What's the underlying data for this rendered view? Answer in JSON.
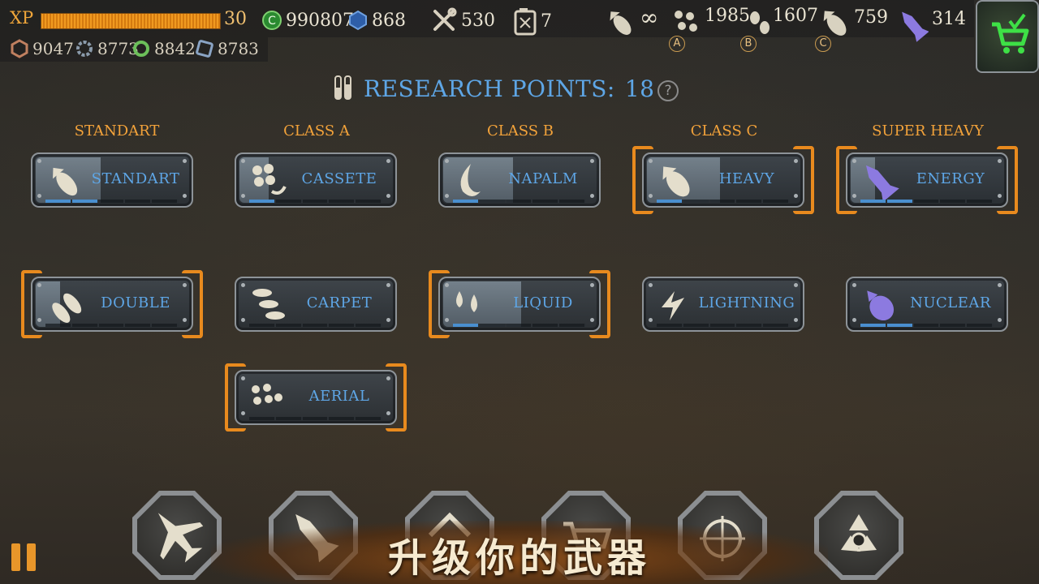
{
  "header": {
    "xp_label": "XP",
    "xp_level": "30",
    "xp_progress": 1.0,
    "credits": "990807",
    "gems": "868",
    "tools": "530",
    "fuel": "7",
    "ammo_standard": "∞",
    "ammo_a": "1985",
    "ammo_b": "1607",
    "ammo_c": "759",
    "ammo_super": "314",
    "sub_a": "A",
    "sub_b": "B",
    "sub_c": "C",
    "mat1": "9047",
    "mat2": "8773",
    "mat3": "8842",
    "mat4": "8783"
  },
  "research": {
    "label": "RESEARCH POINTS:",
    "points": "18",
    "help": "?"
  },
  "columns": [
    "STANDART",
    "CLASS A",
    "CLASS B",
    "CLASS C",
    "SUPER HEAVY"
  ],
  "weapons": {
    "standart": {
      "label": "STANDART",
      "progress": 0.4
    },
    "cassete": {
      "label": "CASSETE",
      "progress": 0.2
    },
    "napalm": {
      "label": "NAPALM",
      "progress": 0.2
    },
    "heavy": {
      "label": "HEAVY",
      "progress": 0.1
    },
    "energy": {
      "label": "ENERGY",
      "progress": 0.4
    },
    "double": {
      "label": "DOUBLE",
      "progress": 0.0
    },
    "carpet": {
      "label": "CARPET",
      "progress": 0.0
    },
    "liquid": {
      "label": "LIQUID",
      "progress": 0.1
    },
    "lightning": {
      "label": "LIGHTNING",
      "progress": 0.0
    },
    "nuclear": {
      "label": "NUCLEAR",
      "progress": 0.3
    },
    "aerial": {
      "label": "AERIAL",
      "progress": 0.0
    }
  },
  "banner": "升级你的武器",
  "colors": {
    "accent": "#5ea6e6",
    "orange": "#e88a1e",
    "progress": "#4a8fd0"
  }
}
